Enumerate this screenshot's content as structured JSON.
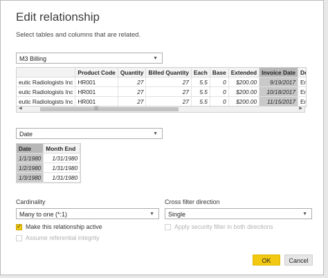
{
  "dialog": {
    "title": "Edit relationship",
    "subtitle": "Select tables and columns that are related."
  },
  "table1": {
    "selected": "M3 Billing",
    "headers": [
      "",
      "Product Code",
      "Quantity",
      "Billed Quantity",
      "Each",
      "Base",
      "Extended",
      "Invoice Date",
      "De"
    ],
    "rows": [
      [
        "eutic Radiologists Inc",
        "HR001",
        "27",
        "27",
        "5.5",
        "0",
        "$200.00",
        "9/19/2017",
        "Em"
      ],
      [
        "eutic Radiologists Inc",
        "HR001",
        "27",
        "27",
        "5.5",
        "0",
        "$200.00",
        "10/18/2017",
        "Em"
      ],
      [
        "eutic Radiologists Inc",
        "HR001",
        "27",
        "27",
        "5.5",
        "0",
        "$200.00",
        "11/15/2017",
        "Em"
      ]
    ]
  },
  "table2": {
    "selected": "Date",
    "headers": [
      "Date",
      "Month End"
    ],
    "rows": [
      [
        "1/1/1980",
        "1/31/1980"
      ],
      [
        "1/2/1980",
        "1/31/1980"
      ],
      [
        "1/3/1980",
        "1/31/1980"
      ]
    ]
  },
  "options": {
    "cardinality_label": "Cardinality",
    "cardinality_value": "Many to one (*:1)",
    "cross_filter_label": "Cross filter direction",
    "cross_filter_value": "Single",
    "active_label": "Make this relationship active",
    "security_label": "Apply security filter in both directions",
    "integrity_label": "Assume referential integrity",
    "checkmark": "✓"
  },
  "buttons": {
    "ok": "OK",
    "cancel": "Cancel"
  },
  "icons": {
    "dropdown": "▼",
    "left": "◀",
    "right": "▶",
    "grip": "|||"
  },
  "colors": {
    "accent": "#f2c811"
  }
}
